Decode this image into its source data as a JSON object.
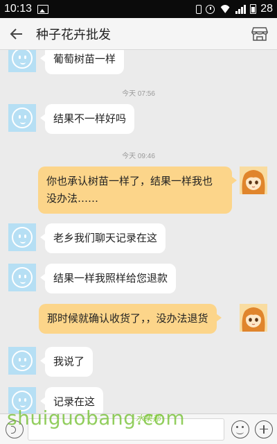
{
  "status_bar": {
    "time": "10:13",
    "battery_level": "28",
    "icons": [
      "image-icon",
      "vibrate-icon",
      "alarm-icon",
      "wifi-icon",
      "signal-icon",
      "battery-icon"
    ]
  },
  "header": {
    "title": "种子花卉批发",
    "back_icon": "arrow-left-icon",
    "store_icon": "store-icon"
  },
  "messages": [
    {
      "side": "left",
      "text": "葡萄树苗一样"
    },
    {
      "timestamp": "今天 07:56"
    },
    {
      "side": "left",
      "text": "结果不一样好吗"
    },
    {
      "timestamp": "今天 09:46"
    },
    {
      "side": "right",
      "text_line1": "你也承认树苗一样了，结果一样我也",
      "text_line2": "没办法……"
    },
    {
      "side": "left",
      "text": "老乡我们聊天记录在这"
    },
    {
      "side": "left",
      "text": "结果一样我照样给您退款"
    },
    {
      "side": "right",
      "text": "那时候就确认收货了，，没办法退货"
    },
    {
      "side": "left",
      "text": "我说了"
    },
    {
      "side": "left",
      "text": "记录在这"
    }
  ],
  "input_bar": {
    "value": "",
    "placeholder": "",
    "icons": [
      "voice-icon",
      "emoji-icon",
      "plus-icon"
    ]
  },
  "watermark": {
    "text": "shuiguobang.com",
    "text_cn": "水果邦"
  },
  "colors": {
    "outgoing_bubble": "#fcd58a",
    "incoming_bubble": "#ffffff",
    "chat_background": "#ebebeb",
    "status_bar": "#0b0b0b",
    "incoming_avatar": "#b6dff4",
    "watermark": "#6ebe28"
  }
}
